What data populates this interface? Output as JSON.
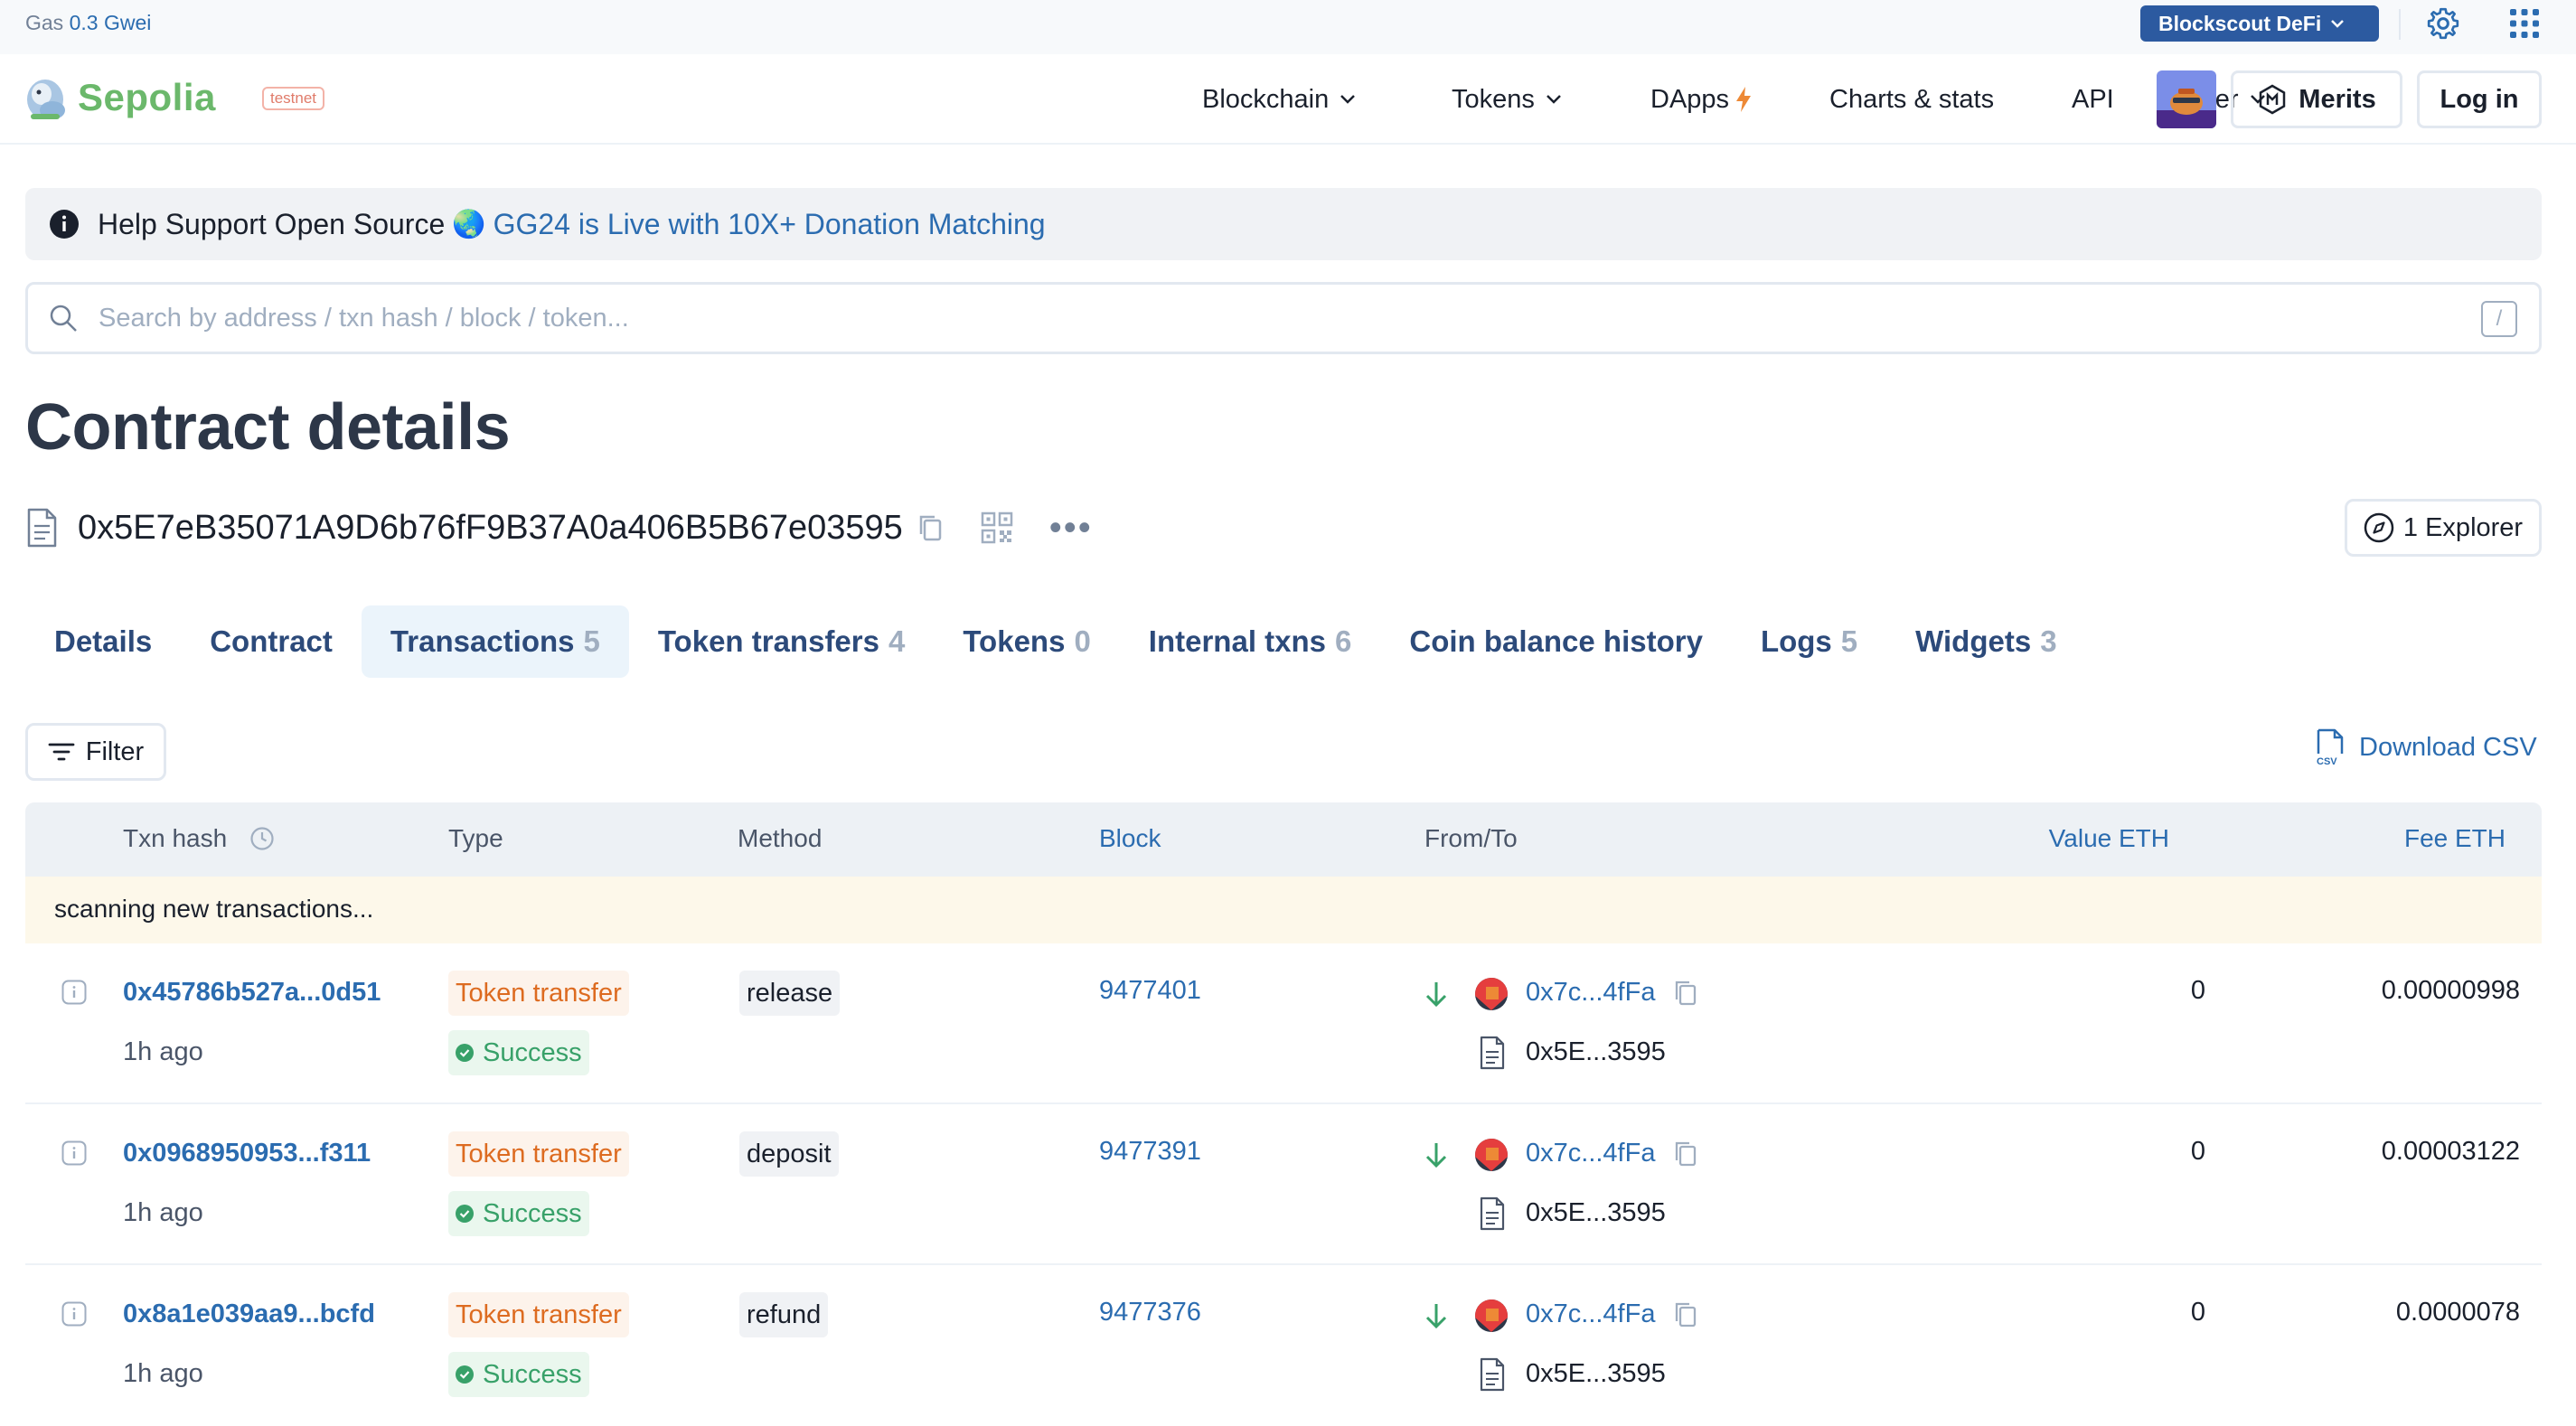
{
  "topbar": {
    "gas_label": "Gas",
    "gas_value": "0.3 Gwei",
    "defi_label": "Blockscout DeFi"
  },
  "header": {
    "logo_name": "Sepolia",
    "badge": "testnet",
    "nav": {
      "blockchain": "Blockchain",
      "tokens": "Tokens",
      "dapps": "DApps",
      "charts": "Charts & stats",
      "api": "API",
      "other": "Other"
    },
    "merits_label": "Merits",
    "login_label": "Log in"
  },
  "announcement": {
    "text": "Help Support Open Source",
    "globe": "🌏",
    "link": "GG24 is Live with 10X+ Donation Matching"
  },
  "search": {
    "placeholder": "Search by address / txn hash / block / token...",
    "shortcut": "/"
  },
  "page": {
    "title": "Contract details",
    "address": "0x5E7eB35071A9D6b76fF9B37A0a406B5B67e03595",
    "explorer_label": "1 Explorer"
  },
  "tabs": [
    {
      "label": "Details",
      "count": ""
    },
    {
      "label": "Contract",
      "count": ""
    },
    {
      "label": "Transactions",
      "count": "5"
    },
    {
      "label": "Token transfers",
      "count": "4"
    },
    {
      "label": "Tokens",
      "count": "0"
    },
    {
      "label": "Internal txns",
      "count": "6"
    },
    {
      "label": "Coin balance history",
      "count": ""
    },
    {
      "label": "Logs",
      "count": "5"
    },
    {
      "label": "Widgets",
      "count": "3"
    }
  ],
  "toolbar": {
    "filter_label": "Filter",
    "csv_label": "Download CSV"
  },
  "table": {
    "headers": {
      "hash": "Txn hash",
      "type": "Type",
      "method": "Method",
      "block": "Block",
      "from_to": "From/To",
      "value": "Value ETH",
      "fee": "Fee ETH"
    },
    "scanning": "scanning new transactions...",
    "rows": [
      {
        "hash": "0x45786b527a...0d51",
        "ago": "1h ago",
        "type": "Token transfer",
        "status": "Success",
        "method": "release",
        "block": "9477401",
        "from": "0x7c...4fFa",
        "to": "0x5E...3595",
        "value": "0",
        "fee": "0.00000998"
      },
      {
        "hash": "0x0968950953...f311",
        "ago": "1h ago",
        "type": "Token transfer",
        "status": "Success",
        "method": "deposit",
        "block": "9477391",
        "from": "0x7c...4fFa",
        "to": "0x5E...3595",
        "value": "0",
        "fee": "0.00003122"
      },
      {
        "hash": "0x8a1e039aa9...bcfd",
        "ago": "1h ago",
        "type": "Token transfer",
        "status": "Success",
        "method": "refund",
        "block": "9477376",
        "from": "0x7c...4fFa",
        "to": "0x5E...3595",
        "value": "0",
        "fee": "0.0000078"
      }
    ]
  },
  "colors": {
    "accent": "#2b6cb0",
    "brand_green": "#6bb86b",
    "transfer_orange": "#dd6b20",
    "success_green": "#38a169"
  }
}
